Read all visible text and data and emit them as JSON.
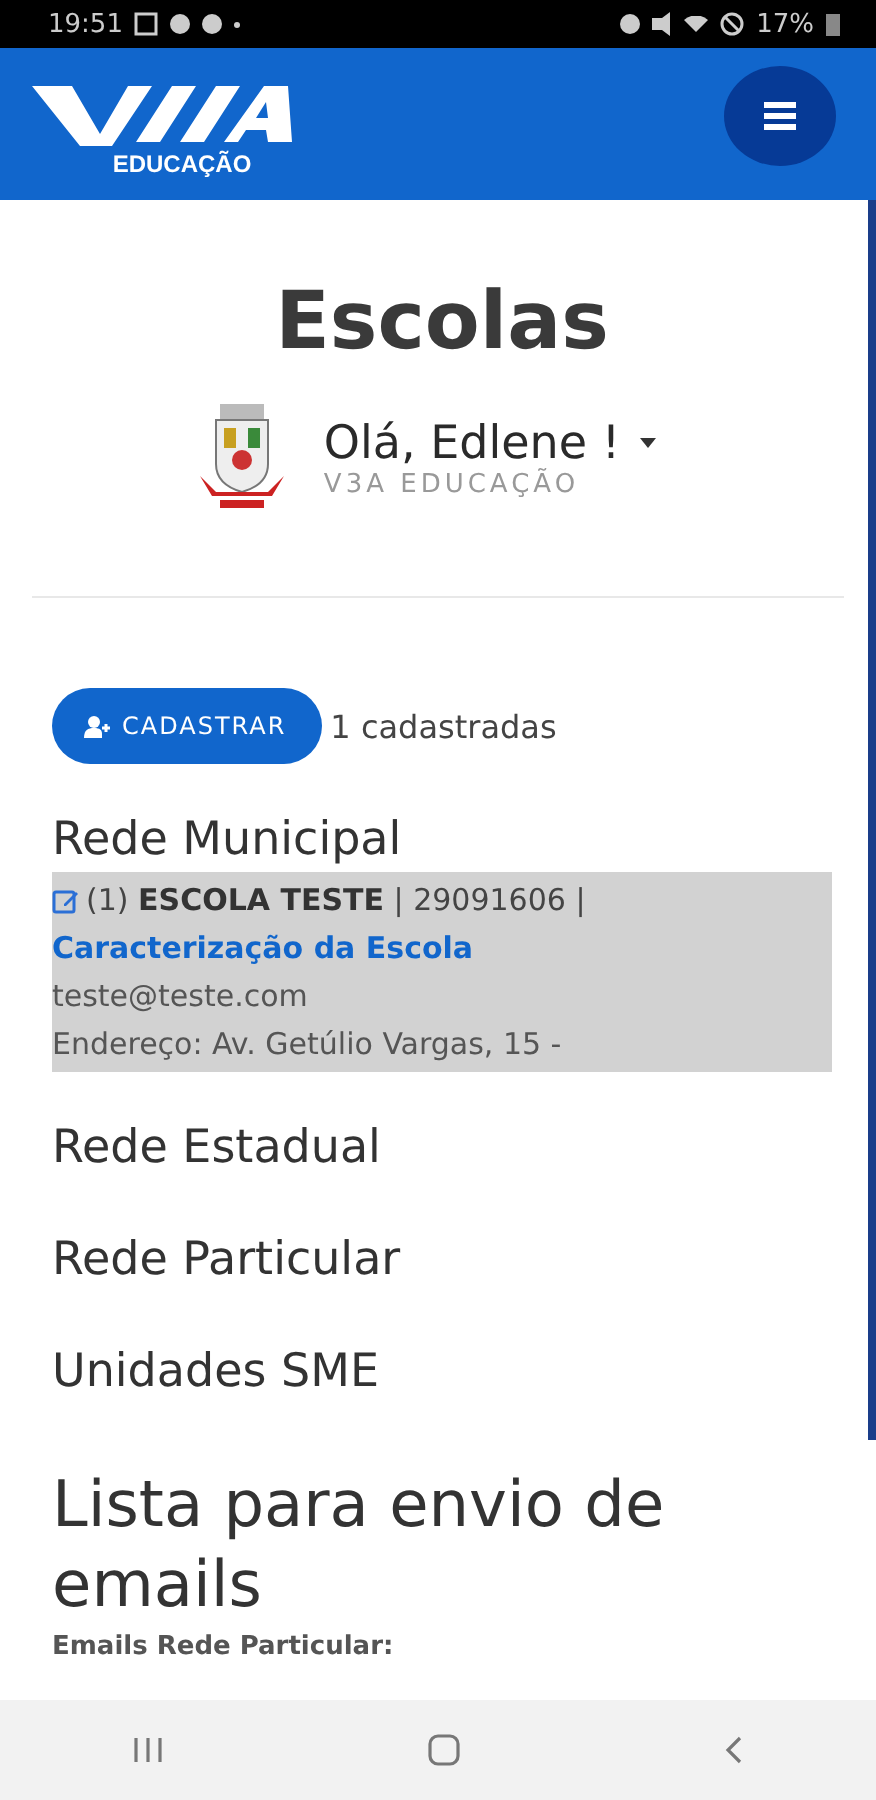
{
  "status_bar": {
    "time": "19:51",
    "battery": "17%"
  },
  "header": {
    "logo_caption": "EDUCAÇÃO"
  },
  "title": "Escolas",
  "user": {
    "greeting": "Olá, Edlene !",
    "organization": "V3A EDUCAÇÃO"
  },
  "register_button": {
    "label": "CADASTRAR"
  },
  "count": "1 cadastradas",
  "sections": [
    {
      "title": "Rede Municipal",
      "schools": [
        {
          "index": "(1)",
          "name": "ESCOLA TESTE",
          "code": "| 29091606 |",
          "link": "Caracterização da Escola",
          "email": "teste@teste.com",
          "address": "Endereço: Av. Getúlio Vargas, 15 -"
        }
      ]
    },
    {
      "title": "Rede Estadual"
    },
    {
      "title": "Rede Particular"
    },
    {
      "title": "Unidades SME"
    }
  ],
  "email_list": {
    "title": "Lista para envio de emails",
    "subtitle": "Emails Rede Particular:"
  }
}
